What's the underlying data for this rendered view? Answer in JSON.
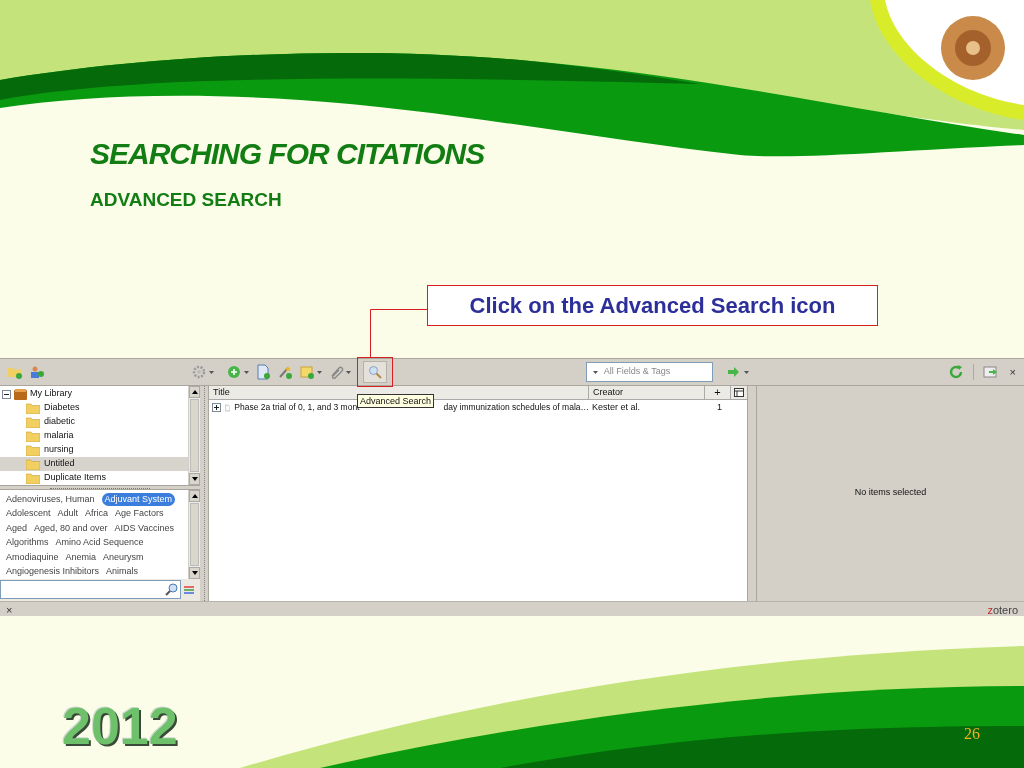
{
  "slide": {
    "title": "SEARCHING FOR CITATIONS",
    "subtitle": "ADVANCED SEARCH",
    "callout": "Click on the Advanced Search icon",
    "year": "2012",
    "page_number": "26"
  },
  "zotero": {
    "toolbar": {
      "tooltip": "Advanced Search",
      "search_placeholder": "All Fields & Tags",
      "close": "×"
    },
    "collections": [
      {
        "label": "My Library",
        "expanded": true,
        "selected": false,
        "children": [
          {
            "label": "Diabetes",
            "selected": false
          },
          {
            "label": "diabetic",
            "selected": false
          },
          {
            "label": "malaria",
            "selected": false
          },
          {
            "label": "nursing",
            "selected": false
          },
          {
            "label": "Untitled",
            "selected": true
          },
          {
            "label": "Duplicate Items",
            "selected": false
          }
        ]
      }
    ],
    "tag_rows": [
      [
        {
          "label": "Adenoviruses, Human",
          "selected": false
        },
        {
          "label": "Adjuvant System",
          "selected": true
        }
      ],
      [
        {
          "label": "Adolescent",
          "selected": false
        },
        {
          "label": "Adult",
          "selected": false
        },
        {
          "label": "Africa",
          "selected": false
        },
        {
          "label": "Age Factors",
          "selected": false
        }
      ],
      [
        {
          "label": "Aged",
          "selected": false
        },
        {
          "label": "Aged, 80 and over",
          "selected": false
        },
        {
          "label": "AIDS Vaccines",
          "selected": false
        }
      ],
      [
        {
          "label": "Algorithms",
          "selected": false
        },
        {
          "label": "Amino Acid Sequence",
          "selected": false
        }
      ],
      [
        {
          "label": "Amodiaquine",
          "selected": false
        },
        {
          "label": "Anemia",
          "selected": false
        },
        {
          "label": "Aneurysm",
          "selected": false
        }
      ],
      [
        {
          "label": "Angiogenesis Inhibitors",
          "selected": false
        },
        {
          "label": "Animals",
          "selected": false
        }
      ]
    ],
    "columns": [
      "Title",
      "Creator",
      "+"
    ],
    "rows": [
      {
        "expanded": false,
        "title_parts": [
          "Phase 2a trial of 0, 1, and 3 mont",
          "day immunization schedules of mala…"
        ],
        "creator": "Kester et al.",
        "column_3": "1"
      }
    ],
    "item_pane": "No items selected",
    "status_close": "×",
    "brand": "zotero"
  }
}
